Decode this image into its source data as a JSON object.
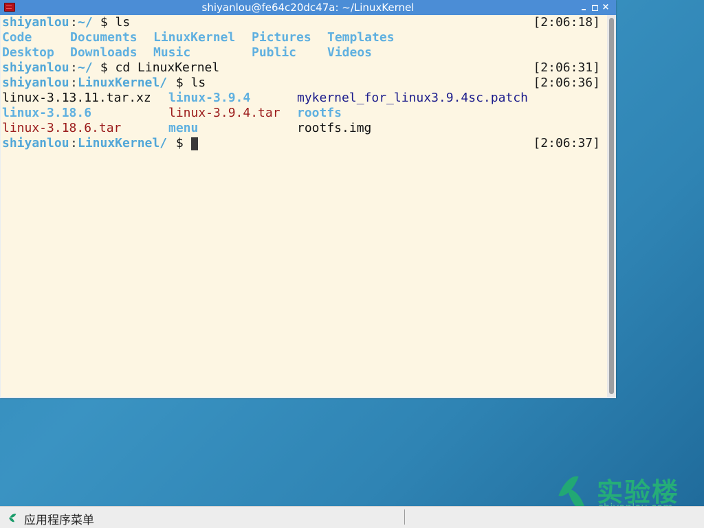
{
  "window": {
    "title": "shiyanlou@fe64c20dc47a: ~/LinuxKernel",
    "buttons": {
      "minimize": "minimize",
      "maximize": "maximize",
      "close": "×"
    }
  },
  "terminal": {
    "prompt_user": "shiyanlou",
    "colon": ":",
    "lines": [
      {
        "path": "~/",
        "command": " $ ls",
        "timestamp": "[2:06:18]"
      },
      {
        "path": "~/",
        "command": " $ cd LinuxKernel",
        "timestamp": "[2:06:31]"
      },
      {
        "path": "LinuxKernel/",
        "command": " $ ls",
        "timestamp": "[2:06:36]"
      },
      {
        "path": "LinuxKernel/",
        "command": " $ ",
        "timestamp": "[2:06:37]"
      }
    ],
    "home_listing": [
      [
        "Code",
        "Documents",
        "LinuxKernel",
        "Pictures",
        "Templates"
      ],
      [
        "Desktop",
        "Downloads",
        "Music",
        "Public",
        "Videos"
      ]
    ],
    "kernel_listing": [
      [
        {
          "name": "linux-3.13.11.tar.xz",
          "type": "file"
        },
        {
          "name": "linux-3.9.4",
          "type": "dir"
        },
        {
          "name": "mykernel_for_linux3.9.4sc.patch",
          "type": "patch"
        }
      ],
      [
        {
          "name": "linux-3.18.6",
          "type": "dir"
        },
        {
          "name": "linux-3.9.4.tar",
          "type": "archive"
        },
        {
          "name": "rootfs",
          "type": "dir"
        }
      ],
      [
        {
          "name": "linux-3.18.6.tar",
          "type": "archive"
        },
        {
          "name": "menu",
          "type": "dir"
        },
        {
          "name": "rootfs.img",
          "type": "file"
        }
      ]
    ],
    "colors": {
      "background": "#fdf6e3",
      "prompt": "#52a7d8",
      "directory": "#5fb0e0",
      "archive": "#9b1b1b",
      "patch": "#1c1c8c",
      "text": "#111111"
    }
  },
  "watermark": {
    "cn": "实验楼",
    "en": "shiyanlou.com"
  },
  "taskbar": {
    "menu_label": "应用程序菜单"
  }
}
